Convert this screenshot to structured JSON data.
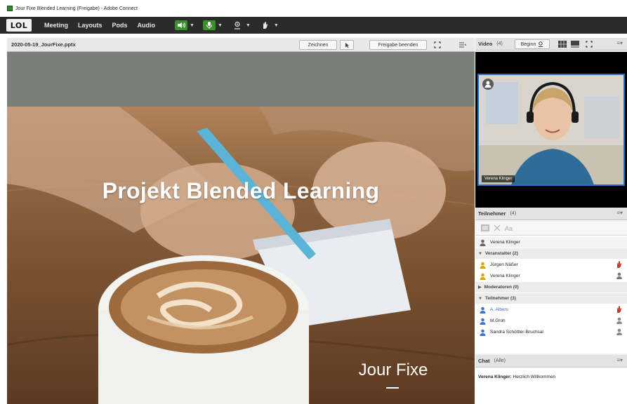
{
  "window": {
    "title": "Jour Fixe Blended Learning (Freigabe) - Adobe Connect"
  },
  "menubar": {
    "logo": "LOL",
    "items": [
      "Meeting",
      "Layouts",
      "Pods",
      "Audio"
    ]
  },
  "share_pod": {
    "filename": "2020-05-19_JourFixe.pptx",
    "draw_label": "Zeichnen",
    "stop_share_label": "Freigabe beenden",
    "slide_title": "Projekt Blended Learning",
    "slide_subtitle": "Jour Fixe",
    "slide_dash": "–"
  },
  "video_pod": {
    "title": "Video",
    "count": "(4)",
    "start_label": "Beginn",
    "presenter_name": "Verena Klinger"
  },
  "attendees_pod": {
    "title": "Teilnehmer",
    "count": "(4)",
    "self": "Verena Klinger",
    "sections": [
      {
        "label": "Veranstalter (2)",
        "expanded": true,
        "people": [
          {
            "name": "Jürgen Näßer",
            "status": "hand-raised",
            "link": false
          },
          {
            "name": "Verena Klinger",
            "status": "speaking",
            "link": false
          }
        ]
      },
      {
        "label": "Moderatoren (0)",
        "expanded": false,
        "people": []
      },
      {
        "label": "Teilnehmer (3)",
        "expanded": true,
        "people": [
          {
            "name": "A. Albers",
            "status": "hand-raised",
            "link": true
          },
          {
            "name": "M.Groh",
            "status": "idle",
            "link": false
          },
          {
            "name": "Sandra Schöttler-Bruchsal",
            "status": "idle",
            "link": false
          }
        ]
      }
    ]
  },
  "chat_pod": {
    "title": "Chat",
    "scope": "(Alle)",
    "message_author": "Verena Klinger:",
    "message_text": "Herzlich Willkommen"
  },
  "colors": {
    "menubar": "#2b2b2b",
    "audio_green": "#3a8f2c",
    "active_video_border": "#2a6fbf",
    "host_icon": "#d9a400",
    "participant_icon": "#3a6fd0"
  }
}
